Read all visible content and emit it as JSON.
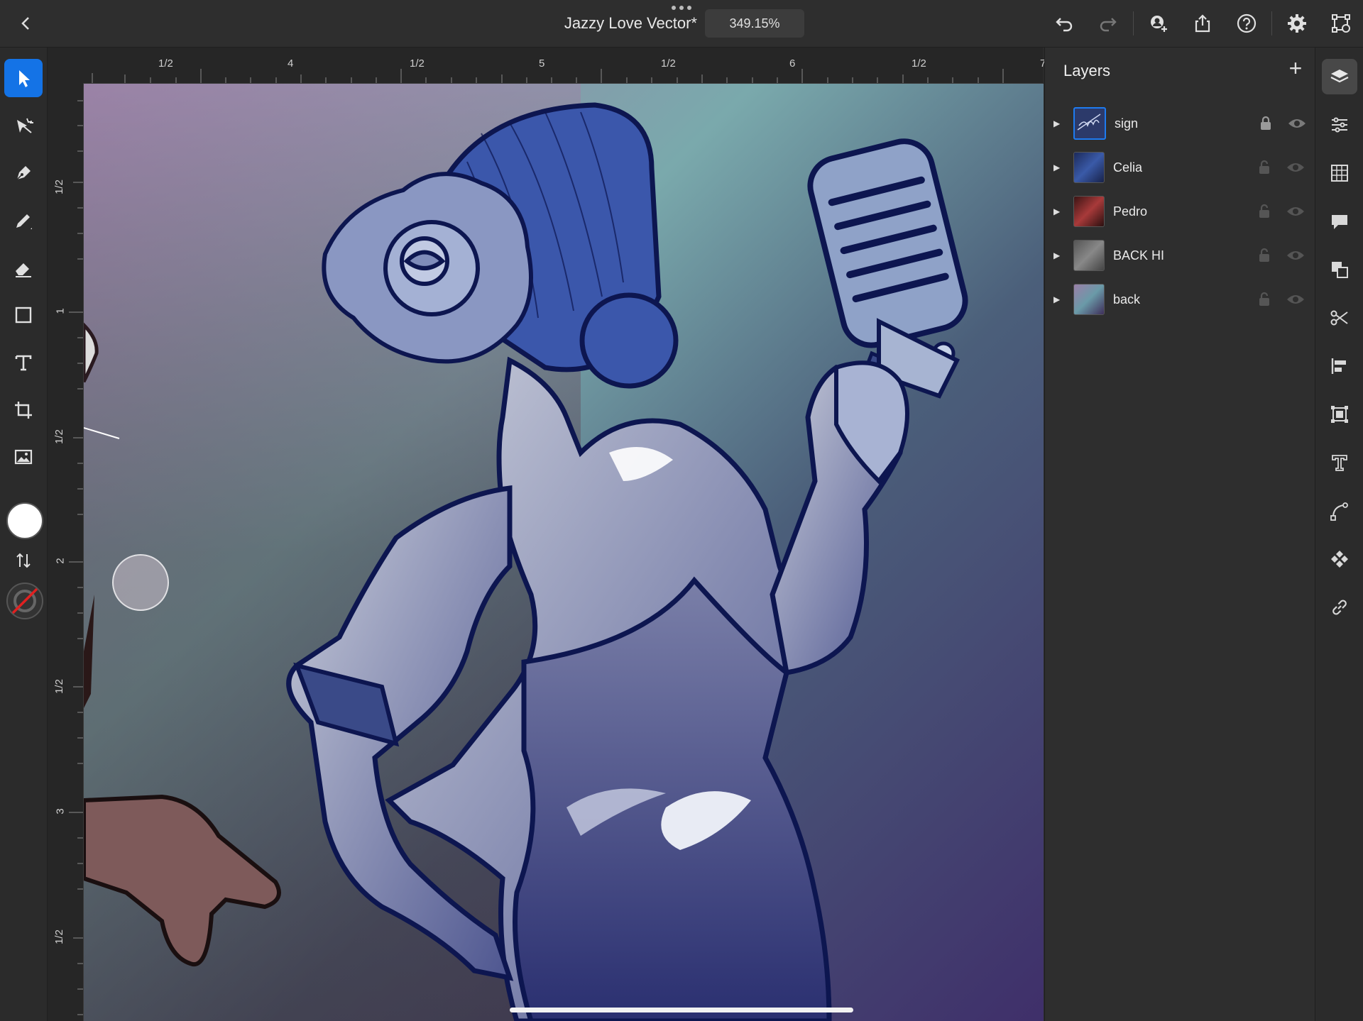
{
  "app": {
    "doc_title": "Jazzy Love Vector*",
    "zoom": "349.15%"
  },
  "topbar": {
    "back_icon": "chevron-left-icon",
    "more_icon": "ellipsis-icon",
    "icons": [
      "undo-icon",
      "redo-icon",
      "invite-icon",
      "share-icon",
      "help-icon",
      "settings-icon",
      "view-icon"
    ]
  },
  "left_tools": [
    "selection-tool",
    "direct-selection-tool",
    "pen-tool",
    "pencil-tool",
    "eraser-tool",
    "shape-tool",
    "type-tool",
    "transform-tool",
    "image-tool"
  ],
  "colors": {
    "fill": "#ffffff",
    "stroke": "none",
    "accent": "#1473e6"
  },
  "rulers": {
    "top": [
      "1/2",
      "4",
      "1/2",
      "5",
      "1/2",
      "6",
      "1/2",
      "7"
    ],
    "left": [
      "1/2",
      "1",
      "1/2",
      "2",
      "1/2",
      "3",
      "1/2"
    ]
  },
  "layers": {
    "title": "Layers",
    "add_icon": "plus-icon",
    "items": [
      {
        "name": "sign",
        "locked": true,
        "visible": true,
        "selected": true
      },
      {
        "name": "Celia",
        "locked": false,
        "visible": true,
        "selected": false
      },
      {
        "name": "Pedro",
        "locked": false,
        "visible": true,
        "selected": false
      },
      {
        "name": "BACK HI",
        "locked": false,
        "visible": true,
        "selected": false
      },
      {
        "name": "back",
        "locked": false,
        "visible": true,
        "selected": false
      }
    ]
  },
  "right_bar": [
    "layers-icon",
    "properties-icon",
    "grid-icon",
    "comments-icon",
    "pathfinder-icon",
    "scissors-icon",
    "align-icon",
    "repeat-grid-icon",
    "type-outline-icon",
    "path-icon",
    "components-icon",
    "link-icon"
  ]
}
